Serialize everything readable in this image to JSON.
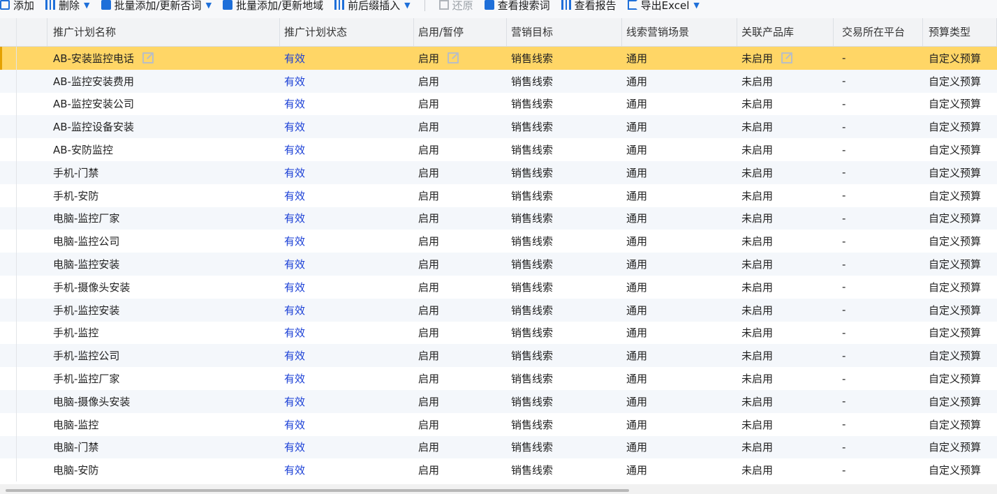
{
  "toolbar": {
    "add_label": "添加",
    "delete_label": "删除",
    "batch_keywords_label": "批量添加/更新否词",
    "batch_region_label": "批量添加/更新地域",
    "prefix_suffix_label": "前后缀插入",
    "restore_label": "还原",
    "view_search_terms_label": "查看搜索词",
    "view_report_label": "查看报告",
    "export_label": "导出Excel"
  },
  "table": {
    "headers": [
      "推广计划名称",
      "推广计划状态",
      "启用/暂停",
      "营销目标",
      "线索营销场景",
      "关联产品库",
      "交易所在平台",
      "预算类型"
    ],
    "rows": [
      [
        "AB-安装监控电话",
        "有效",
        "启用",
        "销售线索",
        "通用",
        "未启用",
        "-",
        "自定义预算"
      ],
      [
        "AB-监控安装费用",
        "有效",
        "启用",
        "销售线索",
        "通用",
        "未启用",
        "-",
        "自定义预算"
      ],
      [
        "AB-监控安装公司",
        "有效",
        "启用",
        "销售线索",
        "通用",
        "未启用",
        "-",
        "自定义预算"
      ],
      [
        "AB-监控设备安装",
        "有效",
        "启用",
        "销售线索",
        "通用",
        "未启用",
        "-",
        "自定义预算"
      ],
      [
        "AB-安防监控",
        "有效",
        "启用",
        "销售线索",
        "通用",
        "未启用",
        "-",
        "自定义预算"
      ],
      [
        "手机-门禁",
        "有效",
        "启用",
        "销售线索",
        "通用",
        "未启用",
        "-",
        "自定义预算"
      ],
      [
        "手机-安防",
        "有效",
        "启用",
        "销售线索",
        "通用",
        "未启用",
        "-",
        "自定义预算"
      ],
      [
        "电脑-监控厂家",
        "有效",
        "启用",
        "销售线索",
        "通用",
        "未启用",
        "-",
        "自定义预算"
      ],
      [
        "电脑-监控公司",
        "有效",
        "启用",
        "销售线索",
        "通用",
        "未启用",
        "-",
        "自定义预算"
      ],
      [
        "电脑-监控安装",
        "有效",
        "启用",
        "销售线索",
        "通用",
        "未启用",
        "-",
        "自定义预算"
      ],
      [
        "手机-摄像头安装",
        "有效",
        "启用",
        "销售线索",
        "通用",
        "未启用",
        "-",
        "自定义预算"
      ],
      [
        "手机-监控安装",
        "有效",
        "启用",
        "销售线索",
        "通用",
        "未启用",
        "-",
        "自定义预算"
      ],
      [
        "手机-监控",
        "有效",
        "启用",
        "销售线索",
        "通用",
        "未启用",
        "-",
        "自定义预算"
      ],
      [
        "手机-监控公司",
        "有效",
        "启用",
        "销售线索",
        "通用",
        "未启用",
        "-",
        "自定义预算"
      ],
      [
        "手机-监控厂家",
        "有效",
        "启用",
        "销售线索",
        "通用",
        "未启用",
        "-",
        "自定义预算"
      ],
      [
        "电脑-摄像头安装",
        "有效",
        "启用",
        "销售线索",
        "通用",
        "未启用",
        "-",
        "自定义预算"
      ],
      [
        "电脑-监控",
        "有效",
        "启用",
        "销售线索",
        "通用",
        "未启用",
        "-",
        "自定义预算"
      ],
      [
        "电脑-门禁",
        "有效",
        "启用",
        "销售线索",
        "通用",
        "未启用",
        "-",
        "自定义预算"
      ],
      [
        "电脑-安防",
        "有效",
        "启用",
        "销售线索",
        "通用",
        "未启用",
        "-",
        "自定义预算"
      ]
    ],
    "selected_row": 0
  },
  "colors": {
    "accent": "#1e6fd9",
    "status_text": "#1a3fd6",
    "selected_row": "#ffd666",
    "header_bg": "#f2f3f5"
  },
  "icons": [
    "plus-icon",
    "delete-icon",
    "batch-add-icon",
    "prefix-suffix-icon",
    "restore-icon",
    "search-terms-icon",
    "report-icon",
    "export-icon",
    "edit-icon",
    "chevron-down-icon"
  ]
}
